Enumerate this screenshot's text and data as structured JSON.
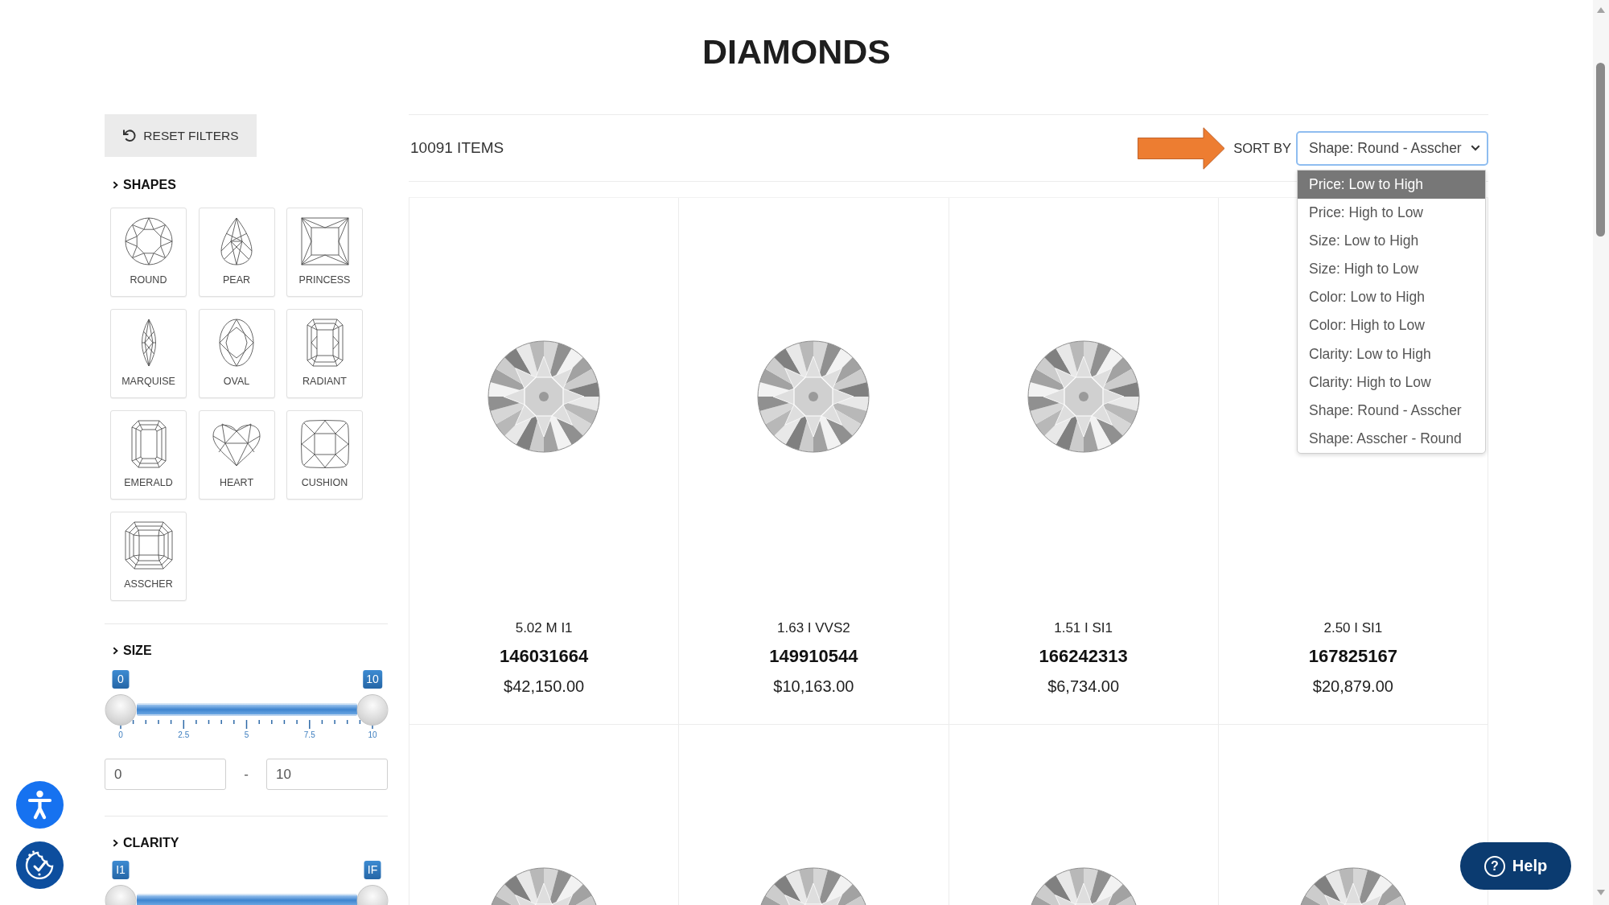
{
  "page": {
    "title": "DIAMONDS"
  },
  "filters": {
    "reset_button": {
      "label": "RESET FILTERS"
    },
    "shapes": {
      "heading": "SHAPES",
      "items": [
        {
          "label": "ROUND",
          "kind": "round",
          "selected": false
        },
        {
          "label": "PEAR",
          "kind": "pear",
          "selected": false
        },
        {
          "label": "PRINCESS",
          "kind": "princess",
          "selected": false
        },
        {
          "label": "MARQUISE",
          "kind": "marquise",
          "selected": false
        },
        {
          "label": "OVAL",
          "kind": "oval",
          "selected": false
        },
        {
          "label": "RADIANT",
          "kind": "radiant",
          "selected": false
        },
        {
          "label": "EMERALD",
          "kind": "emerald",
          "selected": false
        },
        {
          "label": "HEART",
          "kind": "heart",
          "selected": false
        },
        {
          "label": "CUSHION",
          "kind": "cushion",
          "selected": false
        },
        {
          "label": "ASSCHER",
          "kind": "asscher",
          "selected": false
        }
      ]
    },
    "size": {
      "heading": "SIZE",
      "min_badge": "0",
      "max_badge": "10",
      "level": 1,
      "ticks": [
        "0",
        "2.5",
        "5",
        "7.5",
        "10"
      ],
      "min_value": "0",
      "separator": "-",
      "max_value": "10"
    },
    "clarity": {
      "heading": "CLARITY",
      "min_badge": "I1",
      "max_badge": "IF",
      "level": 1
    }
  },
  "results": {
    "count": "10091 ITEMS",
    "highlight_arrow": true,
    "sort": {
      "label": "SORT BY",
      "value": "Shape: Round - Asscher",
      "expanded": true,
      "options": [
        {
          "label": "Price: Low to High",
          "highlighted": true
        },
        {
          "label": "Price: High to Low",
          "highlighted": false
        },
        {
          "label": "Size: Low to High",
          "highlighted": false
        },
        {
          "label": "Size: High to Low",
          "highlighted": false
        },
        {
          "label": "Color: Low to High",
          "highlighted": false
        },
        {
          "label": "Color: High to Low",
          "highlighted": false
        },
        {
          "label": "Clarity: Low to High",
          "highlighted": false
        },
        {
          "label": "Clarity: High to Low",
          "highlighted": false
        },
        {
          "label": "Shape: Round - Asscher",
          "highlighted": false
        },
        {
          "label": "Shape: Asscher - Round",
          "highlighted": false
        }
      ]
    },
    "products": [
      {
        "specs": "5.02 M I1",
        "id": "146031664",
        "price": "$42,150.00",
        "photo_shown": true
      },
      {
        "specs": "1.63 I VVS2",
        "id": "149910544",
        "price": "$10,163.00",
        "photo_shown": true
      },
      {
        "specs": "1.51 I SI1",
        "id": "166242313",
        "price": "$6,734.00",
        "photo_shown": true
      },
      {
        "specs": "2.50 I SI1",
        "id": "167825167",
        "price": "$20,879.00",
        "photo_shown": false
      },
      {
        "photo_shown": true
      },
      {
        "photo_shown": true
      },
      {
        "photo_shown": true
      },
      {
        "photo_shown": true
      }
    ]
  },
  "widgets": [
    {
      "kind": "accessibility"
    },
    {
      "kind": "cookie_consent"
    }
  ],
  "help_button": {
    "icon_glyph": "?",
    "label": "Help"
  }
}
